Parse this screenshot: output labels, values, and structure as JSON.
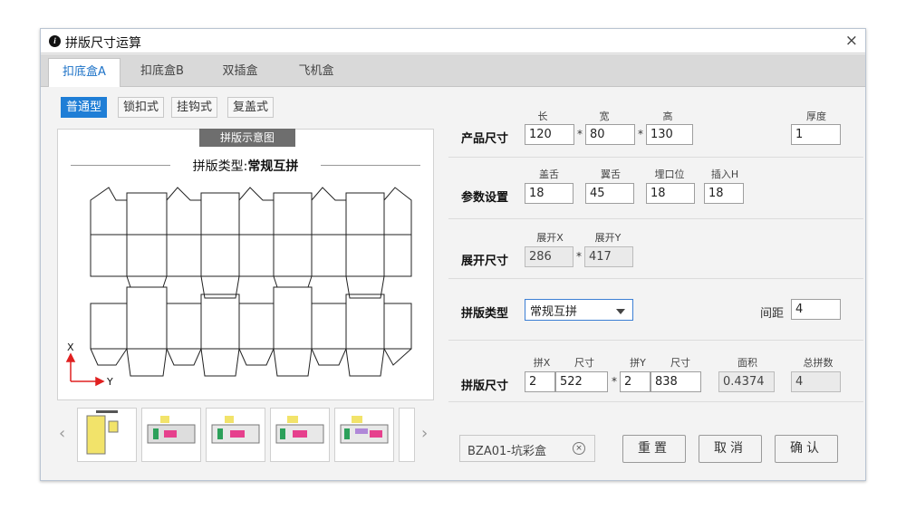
{
  "window": {
    "title": "拼版尺寸运算",
    "close_glyph": "×",
    "icon": "info-icon"
  },
  "tabs": [
    {
      "label": "扣底盒A",
      "active": true
    },
    {
      "label": "扣底盒B",
      "active": false
    },
    {
      "label": "双插盒",
      "active": false
    },
    {
      "label": "飞机盒",
      "active": false
    }
  ],
  "types": [
    {
      "label": "普通型",
      "active": true
    },
    {
      "label": "锁扣式",
      "active": false
    },
    {
      "label": "挂钩式",
      "active": false
    },
    {
      "label": "复盖式",
      "active": false
    }
  ],
  "preview": {
    "tag": "拼版示意图",
    "heading_prefix": "拼版类型:",
    "heading_value": "常规互拼",
    "axis_x": "X",
    "axis_y": "Y"
  },
  "thumbs": {
    "prev": "‹",
    "next": "›",
    "count": 6
  },
  "product": {
    "label": "产品尺寸",
    "len_label": "长",
    "wid_label": "宽",
    "hei_label": "高",
    "thk_label": "厚度",
    "len": "120",
    "wid": "80",
    "hei": "130",
    "thk": "1"
  },
  "params": {
    "label": "参数设置",
    "a_label": "盖舌",
    "b_label": "翼舌",
    "c_label": "埋口位",
    "d_label": "插入H",
    "a": "18",
    "b": "45",
    "c": "18",
    "d": "18"
  },
  "unfold": {
    "label": "展开尺寸",
    "x_label": "展开X",
    "y_label": "展开Y",
    "x": "286",
    "y": "417"
  },
  "layout": {
    "label": "拼版类型",
    "type_value": "常规互拼",
    "gap_label": "间距",
    "gap": "4"
  },
  "result": {
    "label": "拼版尺寸",
    "px_label": "拼X",
    "sx_label": "尺寸",
    "py_label": "拼Y",
    "sy_label": "尺寸",
    "area_label": "面积",
    "total_label": "总拼数",
    "px": "2",
    "sx": "522",
    "py": "2",
    "sy": "838",
    "area": "0.4374",
    "total": "4"
  },
  "footer": {
    "preset": "BZA01-坑彩盒",
    "clear_glyph": "×",
    "reset": "重置",
    "cancel": "取消",
    "confirm": "确认"
  },
  "colors": {
    "accent": "#1f7ed6",
    "tab_active_text": "#1e73c8"
  }
}
